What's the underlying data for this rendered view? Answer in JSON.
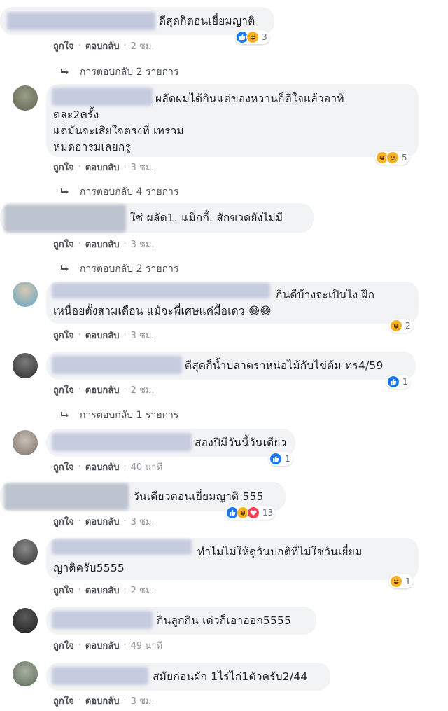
{
  "ui": {
    "like": "ถูกใจ",
    "reply": "ตอบกลับ",
    "dot": "·"
  },
  "colors": {
    "bubble": "#f2f3f5",
    "like_blue": "#1877f2",
    "haha_yellow": "#f7b125",
    "love_red": "#f33e58",
    "meta_gray": "#90949c"
  },
  "comments": [
    {
      "text": "ดีสุดก็ตอนเยี่ยมญาติ",
      "time": "2 ชม.",
      "reactions": [
        "like",
        "haha"
      ],
      "reaction_count": "3",
      "replies_label": "การตอบกลับ 2 รายการ"
    },
    {
      "text": "ผลัดผมได้กินแต่ของหวานก็ดีใจแล้วอาทิ\nตละ2ครั้ง\nแต่มันจะเสียใจตรงที่ เทรวม\nหมดอารมเลยกรู",
      "time": "3 ชม.",
      "reactions": [
        "haha",
        "sad"
      ],
      "reaction_count": "5",
      "replies_label": "การตอบกลับ 4 รายการ"
    },
    {
      "text": "ใช่ ผลัด1. แม็กกี้. สักขวดยังไม่มี",
      "time": "3 ชม.",
      "reactions": [],
      "reaction_count": "",
      "replies_label": "การตอบกลับ 2 รายการ"
    },
    {
      "text": "กินดีบ้างจะเป็นไง ฝึก\nเหนื่อยตั้งสามเดือน แม้จะพี่เศษแค่มื้อเดว 😄😄",
      "time": "3 ชม.",
      "reactions": [
        "haha"
      ],
      "reaction_count": "2",
      "replies_label": ""
    },
    {
      "text": "ดีสุดก็น้ำปลาตราหน่อไม้กับไข่ต้ม ทร4/59",
      "time": "2 ชม.",
      "reactions": [
        "like"
      ],
      "reaction_count": "1",
      "replies_label": "การตอบกลับ 1 รายการ"
    },
    {
      "text": "สองปีมีวันนี้วันเดียว",
      "time": "40 นาที",
      "reactions": [
        "like"
      ],
      "reaction_count": "1",
      "replies_label": ""
    },
    {
      "text": "วันเดียวตอนเยี่ยมญาติ 555",
      "time": "3 ชม.",
      "reactions": [
        "like",
        "haha",
        "love"
      ],
      "reaction_count": "13",
      "replies_label": ""
    },
    {
      "text": "ทำไมไม่ให้ดูวันปกติที่ไม่ใช่วันเยี่ยม\nญาติครับ5555",
      "time": "2 ชม.",
      "reactions": [
        "haha"
      ],
      "reaction_count": "1",
      "replies_label": ""
    },
    {
      "text": "กินลูกกิน เด่วก็เอาออก5555",
      "time": "49 นาที",
      "reactions": [],
      "reaction_count": "",
      "replies_label": ""
    },
    {
      "text": "สมัยก่อนผัก 1ไร่ไก่1ตัวครับ2/44",
      "time": "3 ชม.",
      "reactions": [],
      "reaction_count": "",
      "replies_label": ""
    }
  ]
}
